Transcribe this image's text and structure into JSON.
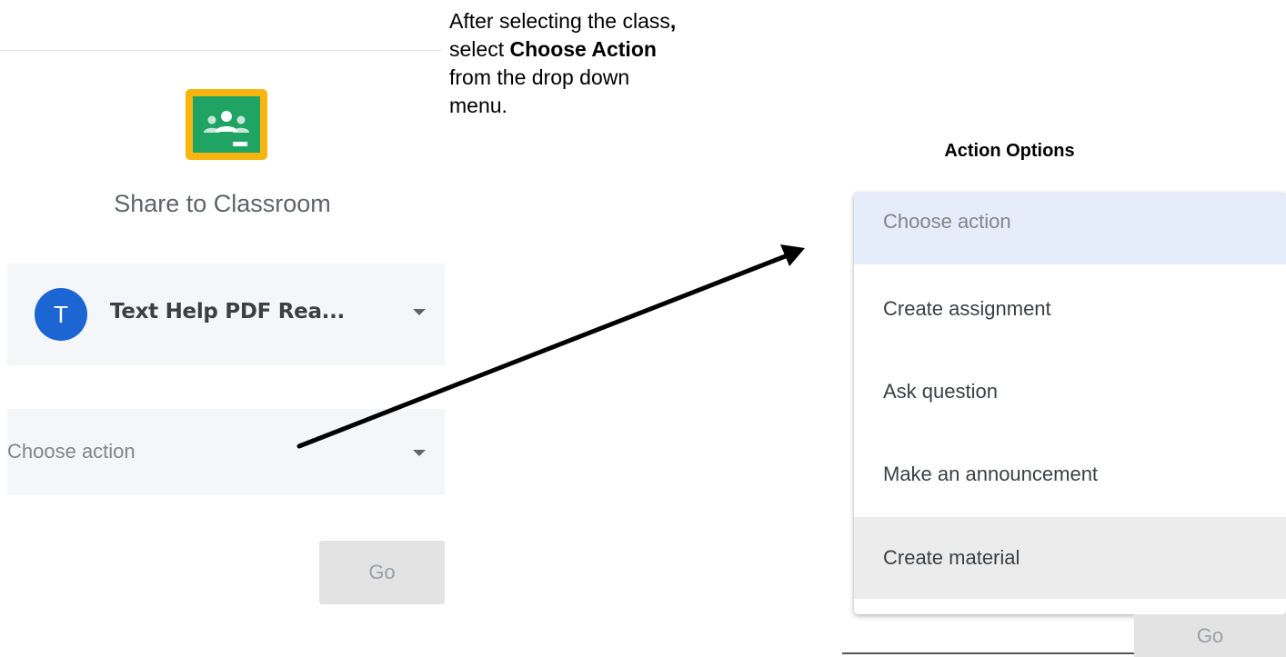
{
  "share_panel": {
    "title": "Share to Classroom",
    "class_select": {
      "avatar_letter": "T",
      "selected_class": "Text Help PDF Rea..."
    },
    "action_select": {
      "placeholder": "Choose action"
    },
    "go_label": "Go",
    "logo_icon": "google-classroom-icon"
  },
  "instruction": {
    "line1": "After selecting the class",
    "line1_comma": ",",
    "line2_prefix": "select ",
    "line2_bold": "Choose Action",
    "line3": "from the drop down",
    "line4": "menu."
  },
  "action_options": {
    "heading": "Action Options",
    "items": [
      {
        "label": "Choose action",
        "state": "selected"
      },
      {
        "label": "Create assignment",
        "state": "normal"
      },
      {
        "label": "Ask question",
        "state": "normal"
      },
      {
        "label": "Make an announcement",
        "state": "normal"
      },
      {
        "label": "Create material",
        "state": "hover"
      }
    ],
    "go_label": "Go"
  },
  "colors": {
    "avatar": "#1b66d2",
    "logo_green": "#20a463",
    "logo_yellow": "#f6b60f",
    "menu_selected": "#e4edf9",
    "menu_hover": "#ececec",
    "select_bg": "#f5f6f8"
  }
}
